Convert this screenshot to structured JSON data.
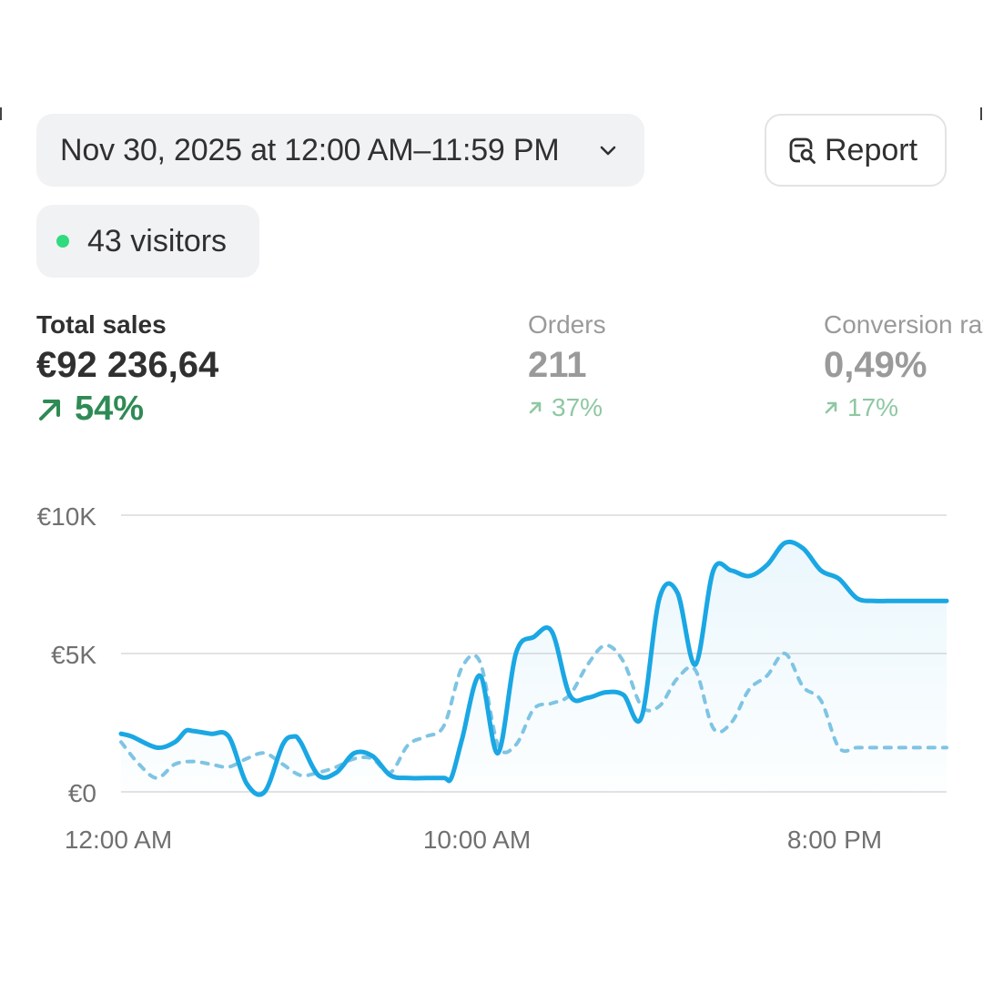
{
  "header": {
    "date_range": "Nov 30, 2025 at 12:00 AM–11:59 PM",
    "report_label": "Report",
    "visitors_label": "43 visitors"
  },
  "metrics": [
    {
      "title": "Total sales",
      "value": "€92 236,64",
      "delta": "54%",
      "trend": "up",
      "active": true
    },
    {
      "title": "Orders",
      "value": "211",
      "delta": "37%",
      "trend": "up",
      "active": false
    },
    {
      "title": "Conversion rate",
      "value": "0,49%",
      "delta": "17%",
      "trend": "up",
      "active": false
    }
  ],
  "icons": {
    "date_chevron": "chevron-down-icon",
    "report": "report-search-icon",
    "visitor_dot": "live-dot-icon",
    "trend": "arrow-up-right-icon"
  },
  "colors": {
    "primary_line": "#1aa7e4",
    "comparison_line": "#7fc4e3",
    "up_trend": "#2f8a55",
    "up_trend_dim": "#8fc7a2",
    "live_dot": "#2fdb7d"
  },
  "chart_data": {
    "type": "line",
    "x_tick_labels": [
      "12:00 AM",
      "10:00 AM",
      "8:00 PM"
    ],
    "y_tick_labels": [
      "€0",
      "€5K",
      "€10K"
    ],
    "ylim": [
      0,
      10000
    ],
    "x_range_hours": [
      0,
      23
    ],
    "grid": true,
    "series": [
      {
        "style": "solid",
        "x": [
          0,
          0.3,
          1,
          1.5,
          1.8,
          2,
          2.5,
          3,
          3.5,
          4,
          4.5,
          4.8,
          5,
          5.5,
          6,
          6.5,
          7,
          7.5,
          8,
          8.5,
          9,
          9.2,
          9.5,
          10,
          10.5,
          11,
          11.5,
          12,
          12.5,
          13,
          13.5,
          14,
          14.5,
          15,
          15.5,
          16,
          16.5,
          17,
          17.5,
          18,
          18.5,
          19,
          19.5,
          20,
          20.5,
          21,
          21.5,
          22,
          22.5,
          23
        ],
        "y": [
          2100,
          2000,
          1600,
          1800,
          2200,
          2200,
          2100,
          2000,
          300,
          0,
          1700,
          2000,
          1800,
          600,
          700,
          1400,
          1300,
          600,
          500,
          500,
          500,
          500,
          1900,
          4200,
          1400,
          5000,
          5600,
          5800,
          3500,
          3400,
          3600,
          3500,
          2700,
          7000,
          7200,
          4600,
          8000,
          8000,
          7800,
          8200,
          9000,
          8800,
          8000,
          7700,
          7000,
          6900,
          6900,
          6900,
          6900,
          6900
        ]
      },
      {
        "style": "dashed",
        "x": [
          0,
          0.5,
          1,
          1.5,
          2,
          2.5,
          3,
          3.5,
          4,
          4.5,
          5,
          5.5,
          6,
          6.5,
          7,
          7.5,
          8,
          8.5,
          9,
          9.5,
          10,
          10.5,
          11,
          11.5,
          12,
          12.5,
          13,
          13.5,
          14,
          14.5,
          15,
          15.5,
          16,
          16.5,
          17,
          17.5,
          18,
          18.5,
          19,
          19.5,
          20,
          20.5,
          21,
          21.5,
          22,
          22.5,
          23
        ],
        "y": [
          1800,
          1000,
          500,
          1000,
          1100,
          1000,
          900,
          1200,
          1400,
          1000,
          600,
          700,
          900,
          1200,
          1200,
          700,
          1700,
          2000,
          2400,
          4500,
          4700,
          1700,
          1700,
          3000,
          3200,
          3500,
          4600,
          5300,
          4700,
          3100,
          3100,
          4100,
          4400,
          2300,
          2500,
          3700,
          4200,
          5000,
          3800,
          3300,
          1600,
          1600,
          1600,
          1600,
          1600,
          1600,
          1600
        ]
      }
    ]
  }
}
